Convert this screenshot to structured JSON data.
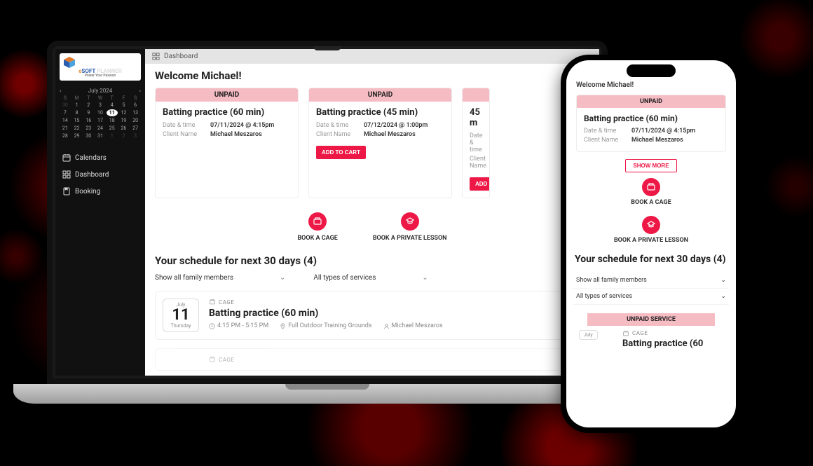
{
  "brand": {
    "name_e": "e",
    "name_soft": "SOFT",
    "name_planner": " PLANNER",
    "tagline": "Power Your Passion"
  },
  "calendar": {
    "month_label": "July 2024",
    "dow": [
      "S",
      "M",
      "T",
      "W",
      "T",
      "F",
      "S"
    ],
    "today": 11,
    "leading_other": [
      30
    ],
    "days": [
      1,
      2,
      3,
      4,
      5,
      6,
      7,
      8,
      9,
      10,
      11,
      12,
      13,
      14,
      15,
      16,
      17,
      18,
      19,
      20,
      21,
      22,
      23,
      24,
      25,
      26,
      27,
      28,
      29,
      30,
      31
    ],
    "trailing_other": [
      1,
      2,
      3
    ]
  },
  "nav": {
    "calendars": "Calendars",
    "dashboard": "Dashboard",
    "booking": "Booking"
  },
  "topbar": {
    "title": "Dashboard"
  },
  "welcome": "Welcome Michael!",
  "cards": [
    {
      "status": "UNPAID",
      "title": "Batting practice (60 min)",
      "datetime_label": "Date & time",
      "datetime": "07/11/2024 @ 4:15pm",
      "client_label": "Client Name",
      "client": "Michael Meszaros",
      "cta": null
    },
    {
      "status": "UNPAID",
      "title": "Batting practice (45 min)",
      "datetime_label": "Date & time",
      "datetime": "07/12/2024 @ 1:00pm",
      "client_label": "Client Name",
      "client": "Michael Meszaros",
      "cta": "ADD TO CART"
    },
    {
      "status": "",
      "title": "45 m",
      "datetime_label": "Date & time",
      "datetime": "",
      "client_label": "Client Name",
      "client": "",
      "cta": "ADD"
    }
  ],
  "actions": {
    "cage": "BOOK A CAGE",
    "lesson": "BOOK A PRIVATE LESSON"
  },
  "schedule": {
    "title": "Your schedule for next 30 days (4)",
    "filter_family": "Show all family members",
    "filter_services": "All types of services",
    "items": [
      {
        "month": "July",
        "day": "11",
        "dow": "Thursday",
        "category": "CAGE",
        "title": "Batting practice (60 min)",
        "time": "4:15 PM - 5:15 PM",
        "location": "Full Outdoor Training Grounds",
        "client": "Michael Meszaros"
      }
    ],
    "next_category": "CAGE"
  },
  "mobile": {
    "welcome": "Welcome Michael!",
    "card": {
      "status": "UNPAID",
      "title": "Batting practice (60 min)",
      "datetime_label": "Date & time",
      "datetime": "07/11/2024 @ 4:15pm",
      "client_label": "Client Name",
      "client": "Michael Meszaros"
    },
    "show_more": "SHOW MORE",
    "action_cage": "BOOK A CAGE",
    "action_lesson": "BOOK A PRIVATE LESSON",
    "sched_title": "Your schedule for next 30 days (4)",
    "filter_family": "Show all family members",
    "filter_services": "All types of services",
    "unpaid_service": "UNPAID SERVICE",
    "category": "CAGE",
    "item_month": "July",
    "item_title": "Batting practice (60"
  },
  "colors": {
    "accent": "#ed1846",
    "pill": "#f6bcc3"
  }
}
